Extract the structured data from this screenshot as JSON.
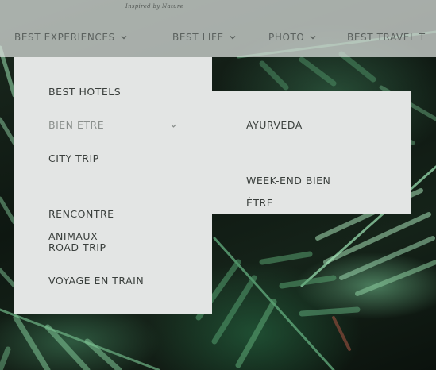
{
  "header": {
    "tagline": "Inspired by Nature",
    "nav": [
      {
        "label": "BEST EXPERIENCES"
      },
      {
        "label": "BEST LIFE"
      },
      {
        "label": "PHOTO"
      },
      {
        "label": "BEST TRAVEL T"
      }
    ]
  },
  "dropdown": {
    "items": [
      {
        "label": "BEST HOTELS"
      },
      {
        "label": "BIEN ETRE",
        "icon": "chevron-down-icon"
      },
      {
        "label": "CITY TRIP"
      },
      {
        "label": "RENCONTRE\nANIMAUX"
      },
      {
        "label": "ROAD TRIP"
      },
      {
        "label": "VOYAGE EN TRAIN"
      }
    ]
  },
  "submenu": {
    "items": [
      {
        "label": "AYURVEDA"
      },
      {
        "label": "WEEK-END BIEN\nÊTRE"
      }
    ]
  },
  "colors": {
    "menu_bg": "#e3e5e4",
    "menu_text": "#3a3f3c",
    "menu_text_active": "#8a8f8c",
    "nav_text": "#5c625f"
  }
}
